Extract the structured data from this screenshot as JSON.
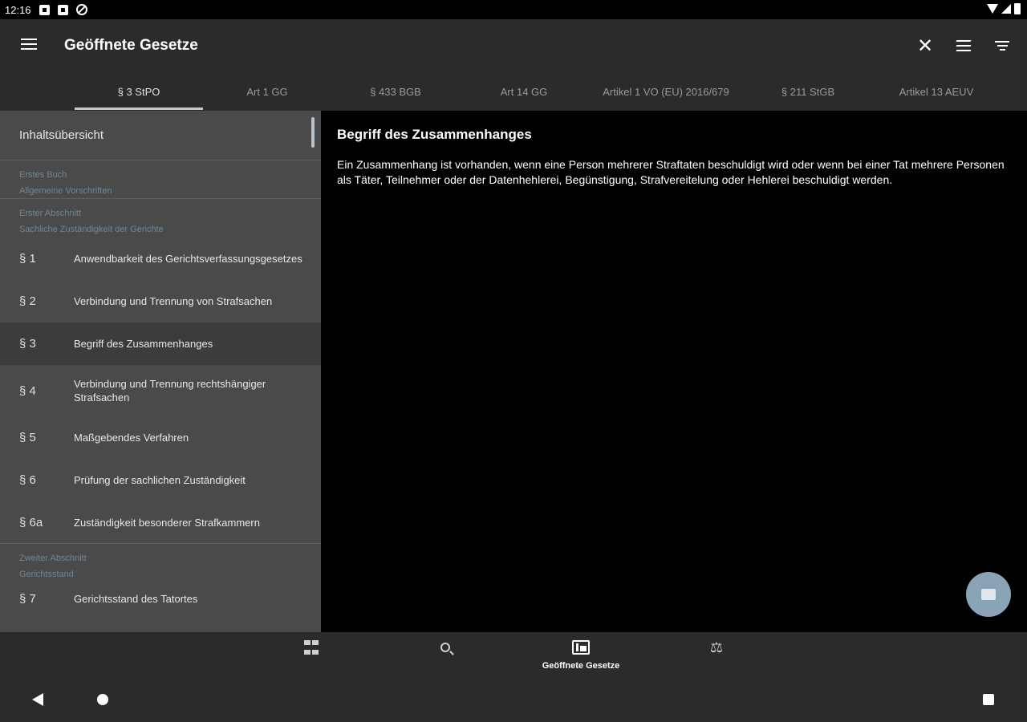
{
  "status_bar": {
    "time": "12:16"
  },
  "app_bar": {
    "title": "Geöffnete Gesetze"
  },
  "tabs": [
    {
      "label": "§ 3 StPO",
      "active": true
    },
    {
      "label": "Art 1 GG"
    },
    {
      "label": "§ 433 BGB"
    },
    {
      "label": "Art 14 GG"
    },
    {
      "label": "Artikel 1 VO (EU) 2016/679"
    },
    {
      "label": "§ 211 StGB"
    },
    {
      "label": "Artikel 13 AEUV"
    }
  ],
  "sidebar": {
    "header": "Inhaltsübersicht",
    "book": {
      "line1": "Erstes Buch",
      "line2": "Allgemeine Vorschriften"
    },
    "section1": {
      "line1": "Erster Abschnitt",
      "line2": "Sachliche Zuständigkeit der Gerichte"
    },
    "paragraphs": [
      {
        "num": "§ 1",
        "title": "Anwendbarkeit des Gerichtsverfassungsgesetzes"
      },
      {
        "num": "§ 2",
        "title": "Verbindung und Trennung von Strafsachen"
      },
      {
        "num": "§ 3",
        "title": "Begriff des Zusammenhanges"
      },
      {
        "num": "§ 4",
        "title": "Verbindung und Trennung rechtshängiger Strafsachen"
      },
      {
        "num": "§ 5",
        "title": "Maßgebendes Verfahren"
      },
      {
        "num": "§ 6",
        "title": "Prüfung der sachlichen Zuständigkeit"
      },
      {
        "num": "§ 6a",
        "title": "Zuständigkeit besonderer Strafkammern"
      }
    ],
    "section2": {
      "line1": "Zweiter Abschnitt",
      "line2": "Gerichtsstand"
    },
    "paragraphs2": [
      {
        "num": "§ 7",
        "title": "Gerichtsstand des Tatortes"
      }
    ]
  },
  "content": {
    "title": "Begriff des Zusammenhanges",
    "text": "Ein Zusammenhang ist vorhanden, wenn eine Person mehrerer Straftaten beschuldigt wird oder wenn bei einer Tat mehrere Personen als Täter, Teilnehmer oder der Datenhehlerei, Begünstigung, Strafvereitelung oder Hehlerei beschuldigt werden."
  },
  "bottom_nav": {
    "items": [
      {
        "icon": "dashboard-icon",
        "label": ""
      },
      {
        "icon": "search-icon",
        "label": ""
      },
      {
        "icon": "open-laws-icon",
        "label": "Geöffnete Gesetze"
      },
      {
        "icon": "scale-icon",
        "label": ""
      }
    ]
  },
  "colors": {
    "app_bar": "#2b2b2b",
    "sidebar": "#4a4a4a",
    "section_label": "#6f8796",
    "fab": "#8aa4b7"
  }
}
